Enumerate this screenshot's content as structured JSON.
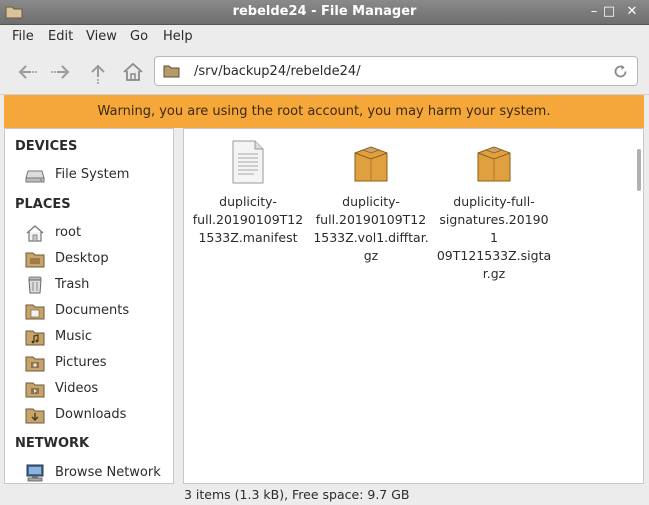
{
  "window": {
    "title": "rebelde24 - File Manager",
    "controls": [
      "–",
      "□",
      "✕"
    ]
  },
  "menu": {
    "file": "File",
    "edit": "Edit",
    "view": "View",
    "go": "Go",
    "help": "Help"
  },
  "toolbar": {
    "icons": [
      "back-icon",
      "forward-icon",
      "up-icon",
      "home-icon"
    ],
    "path": "/srv/backup24/rebelde24/"
  },
  "warning": {
    "text": "Warning, you are using the root account, you may harm your system."
  },
  "sidebar": {
    "devices_heading": "DEVICES",
    "devices": [
      {
        "label": "File System",
        "icon": "drive-icon"
      }
    ],
    "places_heading": "PLACES",
    "places": [
      {
        "label": "root",
        "icon": "home-folder-icon"
      },
      {
        "label": "Desktop",
        "icon": "folder-icon"
      },
      {
        "label": "Trash",
        "icon": "trash-icon"
      },
      {
        "label": "Documents",
        "icon": "documents-folder-icon"
      },
      {
        "label": "Music",
        "icon": "music-folder-icon"
      },
      {
        "label": "Pictures",
        "icon": "pictures-folder-icon"
      },
      {
        "label": "Videos",
        "icon": "videos-folder-icon"
      },
      {
        "label": "Downloads",
        "icon": "downloads-folder-icon"
      }
    ],
    "network_heading": "NETWORK",
    "network": [
      {
        "label": "Browse Network",
        "icon": "network-icon"
      }
    ]
  },
  "files": [
    {
      "name": "duplicity-full.20190109T121533Z.manifest",
      "display": "duplicity-\nfull.20190109T12\n1533Z.manifest",
      "icon": "text-file-icon"
    },
    {
      "name": "duplicity-full.20190109T121533Z.vol1.difftar.gz",
      "display": "duplicity-\nfull.20190109T12\n1533Z.vol1.difftar.\ngz",
      "icon": "archive-icon"
    },
    {
      "name": "duplicity-full-signatures.20190109T121533Z.sigtar.gz",
      "display": "duplicity-full-\nsignatures.201901\n09T121533Z.sigta\nr.gz",
      "icon": "archive-icon"
    }
  ],
  "status": {
    "text": "3 items (1.3 kB), Free space: 9.7 GB"
  },
  "colors": {
    "warning_bg": "#f5a73a",
    "titlebar": "#7a7a7a",
    "folder": "#c8a46a",
    "archive": "#e0a040"
  }
}
